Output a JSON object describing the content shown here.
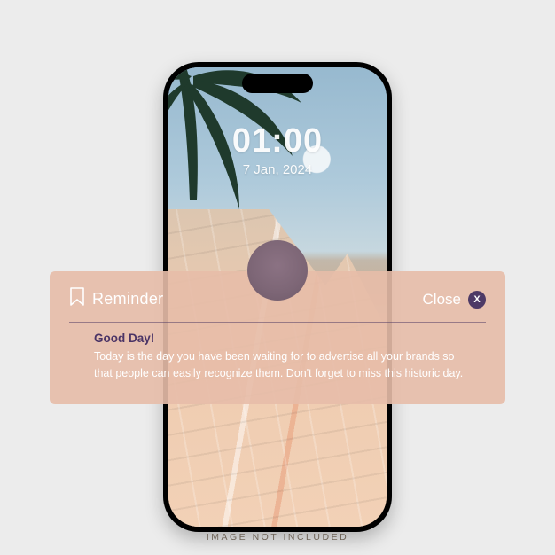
{
  "lockscreen": {
    "time": "01:00",
    "date": "7 Jan, 2024"
  },
  "reminder": {
    "title": "Reminder",
    "close_label": "Close",
    "close_glyph": "X",
    "greeting": "Good Day!",
    "body": "Today is the day you have been waiting for to advertise all your brands so that people can easily recognize them. Don't forget to miss this historic day."
  },
  "footer": {
    "note": "IMAGE NOT INCLUDED"
  },
  "colors": {
    "accent_purple": "#4e3a66",
    "card_bg": "rgba(231,189,169,0.9)"
  }
}
